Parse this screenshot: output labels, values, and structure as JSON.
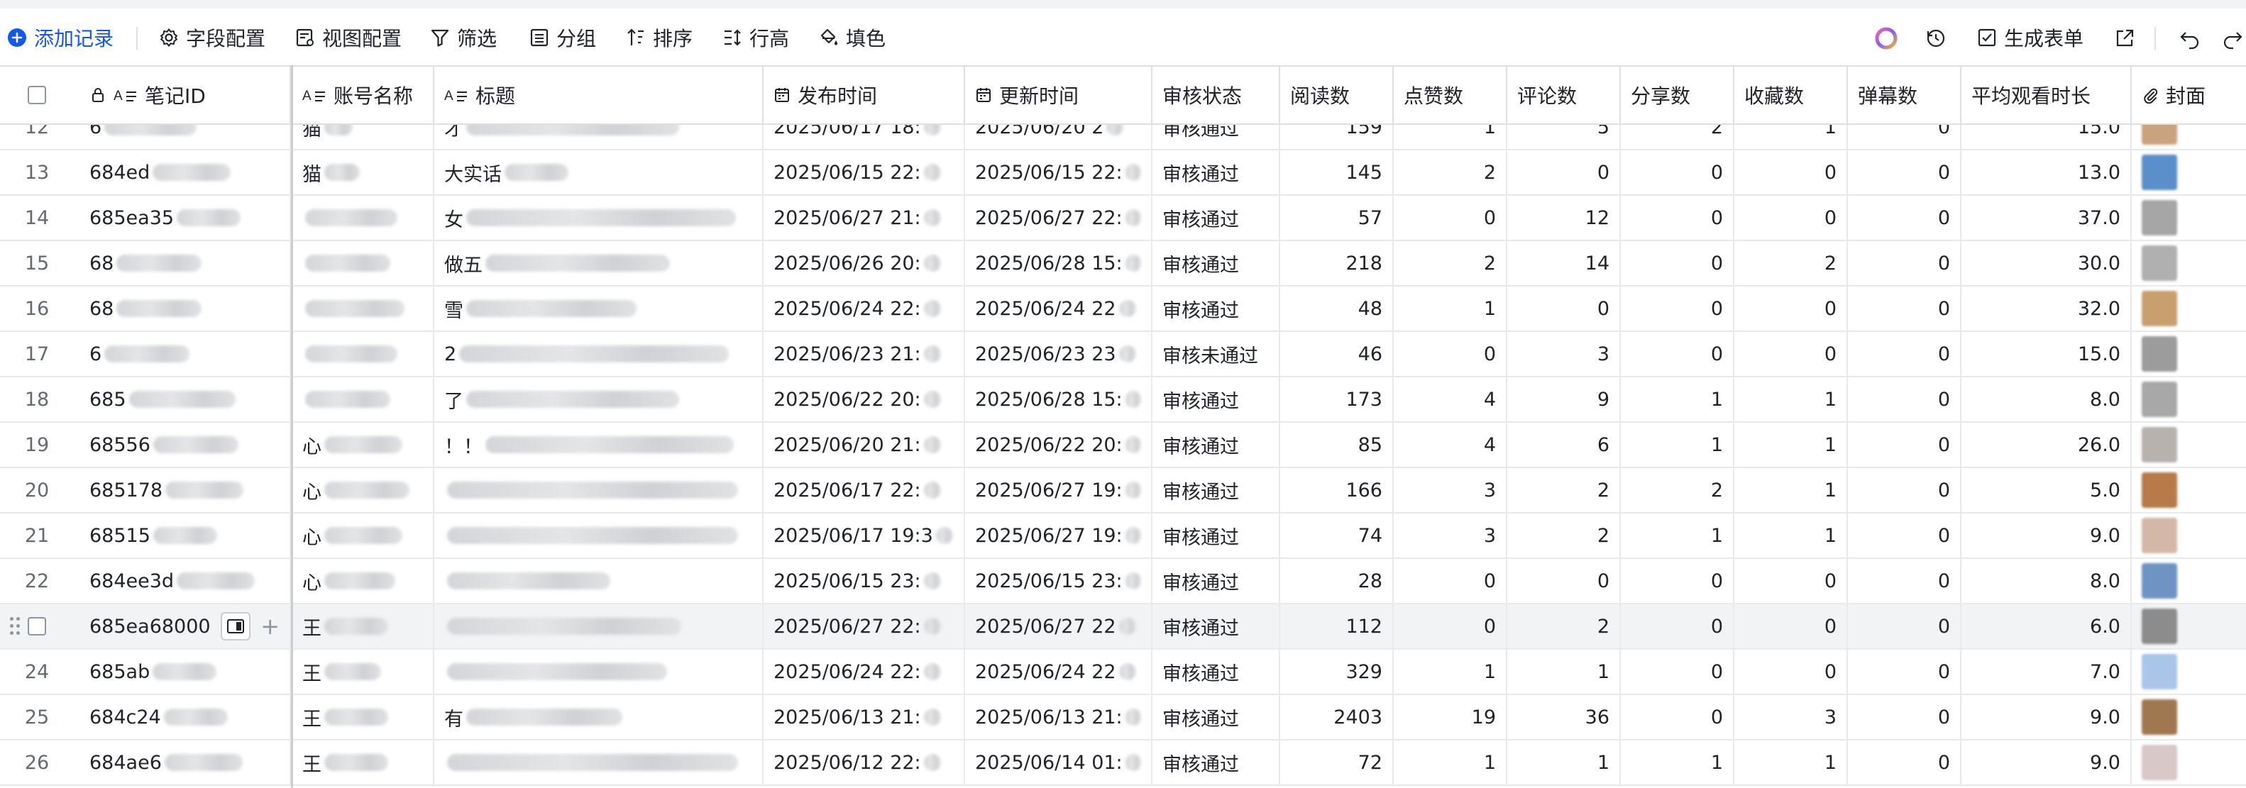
{
  "toolbar": {
    "add_record": "添加记录",
    "field_config": "字段配置",
    "view_config": "视图配置",
    "filter": "筛选",
    "group": "分组",
    "sort": "排序",
    "row_height": "行高",
    "fill_color": "填色",
    "generate_form": "生成表单"
  },
  "columns": {
    "note_id": "笔记ID",
    "account_name": "账号名称",
    "title": "标题",
    "publish_time": "发布时间",
    "update_time": "更新时间",
    "review_status": "审核状态",
    "reads": "阅读数",
    "likes": "点赞数",
    "comments": "评论数",
    "shares": "分享数",
    "favorites": "收藏数",
    "danmaku": "弹幕数",
    "avg_watch": "平均观看时长",
    "cover": "封面"
  },
  "rows": [
    {
      "idx": "12",
      "id": "6",
      "acct": "猫",
      "title": "才",
      "pub": "2025/06/17 18:",
      "upd": "2025/06/20 2",
      "status": "审核通过",
      "reads": "159",
      "likes": "1",
      "comments": "5",
      "shares": "2",
      "favs": "1",
      "danmaku": "0",
      "avg": "15.0",
      "cover": "#c9a27e"
    },
    {
      "idx": "13",
      "id": "684ed",
      "acct": "猫",
      "title": "大实话",
      "pub": "2025/06/15 22:",
      "upd": "2025/06/15 22:",
      "status": "审核通过",
      "reads": "145",
      "likes": "2",
      "comments": "0",
      "shares": "0",
      "favs": "0",
      "danmaku": "0",
      "avg": "13.0",
      "cover": "#5b8fc9"
    },
    {
      "idx": "14",
      "id": "685ea35",
      "acct": "",
      "title": "女",
      "pub": "2025/06/27 21:",
      "upd": "2025/06/27 22:",
      "status": "审核通过",
      "reads": "57",
      "likes": "0",
      "comments": "12",
      "shares": "0",
      "favs": "0",
      "danmaku": "0",
      "avg": "37.0",
      "cover": "#a6a6a6"
    },
    {
      "idx": "15",
      "id": "68",
      "acct": "",
      "title": "做五",
      "pub": "2025/06/26 20:",
      "upd": "2025/06/28 15:",
      "status": "审核通过",
      "reads": "218",
      "likes": "2",
      "comments": "14",
      "shares": "0",
      "favs": "2",
      "danmaku": "0",
      "avg": "30.0",
      "cover": "#b0b0b0"
    },
    {
      "idx": "16",
      "id": "68",
      "acct": "",
      "title": "雪",
      "pub": "2025/06/24 22:",
      "upd": "2025/06/24 22",
      "status": "审核通过",
      "reads": "48",
      "likes": "1",
      "comments": "0",
      "shares": "0",
      "favs": "0",
      "danmaku": "0",
      "avg": "32.0",
      "cover": "#c8a070"
    },
    {
      "idx": "17",
      "id": "6",
      "acct": "",
      "title": "2",
      "pub": "2025/06/23 21:",
      "upd": "2025/06/23 23",
      "status": "审核未通过",
      "reads": "46",
      "likes": "0",
      "comments": "3",
      "shares": "0",
      "favs": "0",
      "danmaku": "0",
      "avg": "15.0",
      "cover": "#9c9c9c"
    },
    {
      "idx": "18",
      "id": "685",
      "acct": "",
      "title": "了",
      "pub": "2025/06/22 20:",
      "upd": "2025/06/28 15:",
      "status": "审核通过",
      "reads": "173",
      "likes": "4",
      "comments": "9",
      "shares": "1",
      "favs": "1",
      "danmaku": "0",
      "avg": "8.0",
      "cover": "#a8a8a8"
    },
    {
      "idx": "19",
      "id": "68556",
      "acct": "心",
      "title": "！！",
      "pub": "2025/06/20 21:",
      "upd": "2025/06/22 20:",
      "status": "审核通过",
      "reads": "85",
      "likes": "4",
      "comments": "6",
      "shares": "1",
      "favs": "1",
      "danmaku": "0",
      "avg": "26.0",
      "cover": "#b7b2ad"
    },
    {
      "idx": "20",
      "id": "685178",
      "acct": "心",
      "title": "",
      "pub": "2025/06/17 22:",
      "upd": "2025/06/27 19:",
      "status": "审核通过",
      "reads": "166",
      "likes": "3",
      "comments": "2",
      "shares": "2",
      "favs": "1",
      "danmaku": "0",
      "avg": "5.0",
      "cover": "#b87a48"
    },
    {
      "idx": "21",
      "id": "68515",
      "acct": "心",
      "title": "",
      "pub": "2025/06/17 19:3",
      "upd": "2025/06/27 19:",
      "status": "审核通过",
      "reads": "74",
      "likes": "3",
      "comments": "2",
      "shares": "1",
      "favs": "1",
      "danmaku": "0",
      "avg": "9.0",
      "cover": "#d3b8a8"
    },
    {
      "idx": "22",
      "id": "684ee3d",
      "acct": "心",
      "title": "",
      "pub": "2025/06/15 23:",
      "upd": "2025/06/15 23:",
      "status": "审核通过",
      "reads": "28",
      "likes": "0",
      "comments": "0",
      "shares": "0",
      "favs": "0",
      "danmaku": "0",
      "avg": "8.0",
      "cover": "#6f94c4"
    },
    {
      "idx": "",
      "id": "685ea68000",
      "acct": "王",
      "title": "",
      "pub": "2025/06/27 22:",
      "upd": "2025/06/27 22",
      "status": "审核通过",
      "reads": "112",
      "likes": "0",
      "comments": "2",
      "shares": "0",
      "favs": "0",
      "danmaku": "0",
      "avg": "6.0",
      "cover": "#8c8c8c",
      "hover": true
    },
    {
      "idx": "24",
      "id": "685ab",
      "acct": "王",
      "title": "",
      "pub": "2025/06/24 22:",
      "upd": "2025/06/24 22",
      "status": "审核通过",
      "reads": "329",
      "likes": "1",
      "comments": "1",
      "shares": "0",
      "favs": "0",
      "danmaku": "0",
      "avg": "7.0",
      "cover": "#a9c6e8"
    },
    {
      "idx": "25",
      "id": "684c24",
      "acct": "王",
      "title": "有",
      "pub": "2025/06/13 21:",
      "upd": "2025/06/13 21:",
      "status": "审核通过",
      "reads": "2403",
      "likes": "19",
      "comments": "36",
      "shares": "0",
      "favs": "3",
      "danmaku": "0",
      "avg": "9.0",
      "cover": "#a07850"
    },
    {
      "idx": "26",
      "id": "684ae6",
      "acct": "王",
      "title": "",
      "pub": "2025/06/12 22:",
      "upd": "2025/06/14 01:",
      "status": "审核通过",
      "reads": "72",
      "likes": "1",
      "comments": "1",
      "shares": "1",
      "favs": "1",
      "danmaku": "0",
      "avg": "9.0",
      "cover": "#d8c8c8"
    }
  ],
  "colors": {
    "accent": "#1456f0",
    "border": "#dee0e3",
    "hover_row": "#f2f3f5",
    "text": "#1f2329",
    "muted": "#646a73"
  }
}
